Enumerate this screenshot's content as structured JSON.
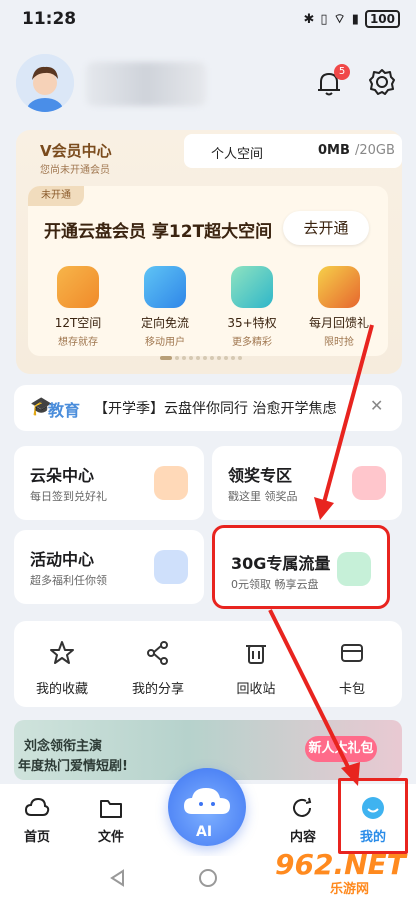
{
  "status_bar": {
    "time": "11:28",
    "battery": "100",
    "icons": [
      "bluetooth-icon",
      "vibrate-icon",
      "wifi-icon",
      "signal-icon"
    ]
  },
  "header": {
    "notification_count": "5"
  },
  "vip": {
    "title": "V会员中心",
    "subtitle": "您尚未开通会员",
    "space_label": "个人空间",
    "space_used": "0MB",
    "space_total": "/20GB",
    "tag": "未开通",
    "promo": "开通云盘会员  享12T超大空间",
    "open_button": "去开通",
    "benefits": [
      {
        "title": "12T空间",
        "sub": "想存就存",
        "icon": "storage-icon"
      },
      {
        "title": "定向免流",
        "sub": "移动用户",
        "icon": "wifi-icon"
      },
      {
        "title": "35+特权",
        "sub": "更多精彩",
        "icon": "privilege-icon"
      },
      {
        "title": "每月回馈礼",
        "sub": "限时抢",
        "icon": "gift-icon"
      }
    ]
  },
  "edu": {
    "label": "教育",
    "text": "【开学季】云盘伴你同行 治愈开学焦虑"
  },
  "cards": [
    {
      "title": "云朵中心",
      "sub": "每日签到兑好礼",
      "icon_color": "#ff9a4a"
    },
    {
      "title": "领奖专区",
      "sub": "戳这里 领奖品",
      "icon_color": "#ff6b7a"
    },
    {
      "title": "活动中心",
      "sub": "超多福利任你领",
      "icon_color": "#6fa8ee"
    },
    {
      "title": "30G专属流量",
      "sub": "0元领取 畅享云盘",
      "icon_color": "#4fcf8a"
    }
  ],
  "tools": [
    {
      "label": "我的收藏",
      "icon": "star-icon"
    },
    {
      "label": "我的分享",
      "icon": "share-icon"
    },
    {
      "label": "回收站",
      "icon": "trash-icon"
    },
    {
      "label": "卡包",
      "icon": "card-icon"
    }
  ],
  "drama": {
    "line1": "刘念领衔主演",
    "line2": "年度热门爱情短剧!",
    "button": "新人大礼包"
  },
  "nav": {
    "items": [
      {
        "label": "首页",
        "icon": "cloud-icon"
      },
      {
        "label": "文件",
        "icon": "folder-icon"
      },
      {
        "label": "内容",
        "icon": "refresh-icon"
      },
      {
        "label": "我的",
        "icon": "face-icon"
      }
    ],
    "ai_label": "AI"
  },
  "watermark": {
    "text": "962.NET",
    "sub": "乐游网"
  },
  "colors": {
    "accent": "#3d74f2",
    "highlight_box": "#e8241f",
    "vip_brown": "#7a4b1d"
  }
}
